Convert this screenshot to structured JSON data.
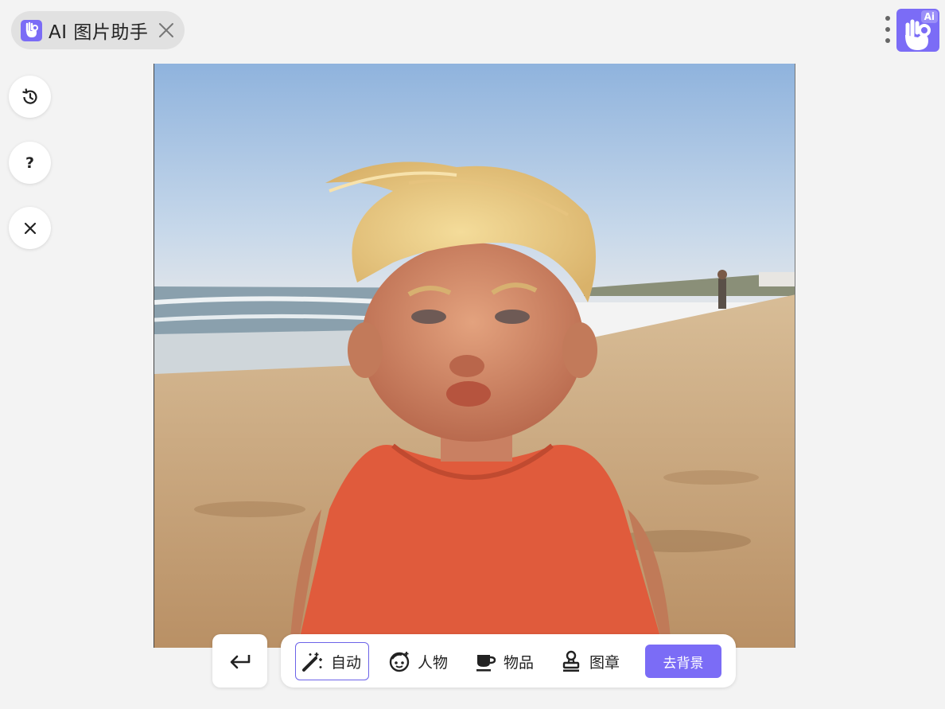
{
  "app": {
    "title": "AI 图片助手",
    "badge_text": "Ai"
  },
  "icons": {
    "app_logo": "hand-ok-icon",
    "close": "close-icon",
    "more": "more-vertical-icon",
    "history": "history-icon",
    "help": "help-icon",
    "exit": "close-icon",
    "back": "return-arrow-icon",
    "auto": "magic-wand-icon",
    "person": "face-icon",
    "object": "cup-icon",
    "stamp": "stamp-icon"
  },
  "sidebar": {
    "help_label": "?"
  },
  "toolbar": {
    "tools": [
      {
        "label": "自动",
        "active": true
      },
      {
        "label": "人物",
        "active": false
      },
      {
        "label": "物品",
        "active": false
      },
      {
        "label": "图章",
        "active": false
      }
    ],
    "primary_label": "去背景"
  },
  "colors": {
    "accent": "#7b6cf6",
    "background": "#f3f3f3",
    "active_border": "#6c63e8"
  }
}
